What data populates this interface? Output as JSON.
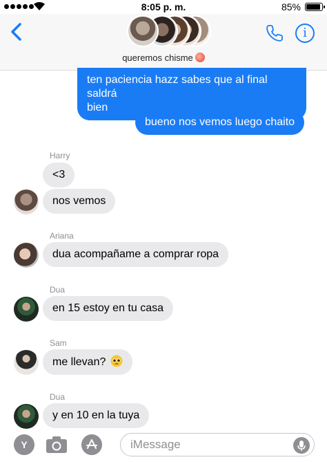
{
  "status_bar": {
    "time": "8:05 p. m.",
    "battery_percent": "85%",
    "battery_level": 0.85
  },
  "header": {
    "group_name": "queremos chisme",
    "back_icon": "chevron-left-icon",
    "phone_icon": "phone-icon",
    "info_icon": "info-icon",
    "info_glyph": "i"
  },
  "messages": {
    "out1": "ten paciencia hazz sabes que al final saldrá",
    "out1b": "bien",
    "out2": "bueno nos vemos luego chaito",
    "harry_name": "Harry",
    "harry1": "<3",
    "harry2": "nos vemos",
    "ariana_name": "Ariana",
    "ariana1": "dua acompañame a comprar ropa",
    "dua_name": "Dua",
    "dua1": "en 15 estoy en tu casa",
    "sam_name": "Sam",
    "sam1": "me llevan?",
    "dua_name2": "Dua",
    "dua2": "y en 10 en la tuya"
  },
  "bottom_bar": {
    "app_drawer_glyph": "Y",
    "input_placeholder": "iMessage"
  },
  "colors": {
    "accent": "#1a7cf5",
    "incoming_bubble": "#e9e9eb"
  }
}
